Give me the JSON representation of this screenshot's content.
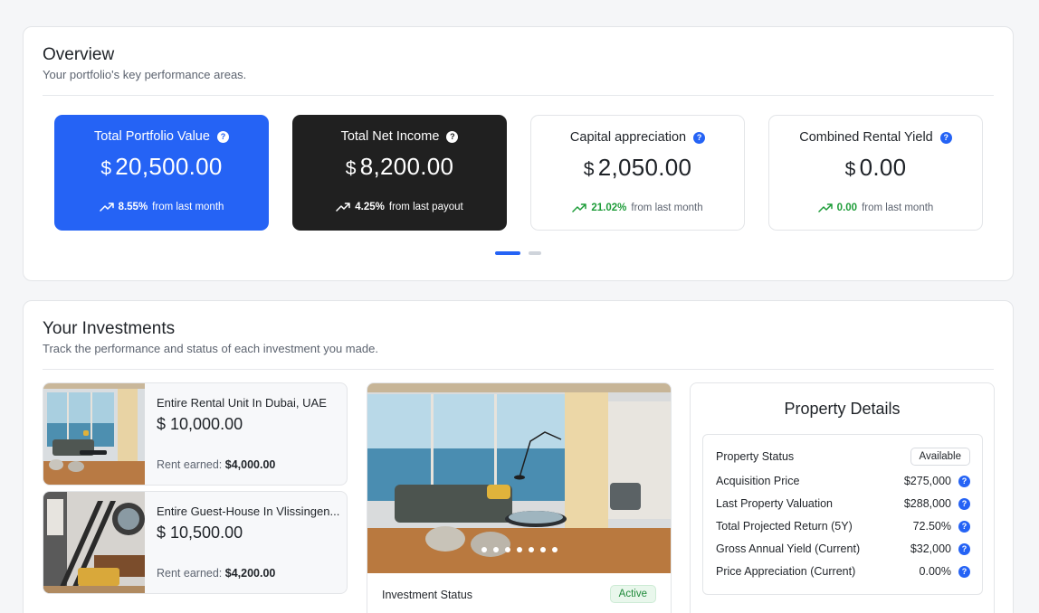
{
  "overview": {
    "title": "Overview",
    "subtitle": "Your portfolio's key performance areas.",
    "cards": [
      {
        "title": "Total Portfolio Value",
        "currency": "$",
        "value": "20,500.00",
        "pct": "8.55%",
        "note": "from last month"
      },
      {
        "title": "Total Net Income",
        "currency": "$",
        "value": "8,200.00",
        "pct": "4.25%",
        "note": "from last payout"
      },
      {
        "title": "Capital appreciation",
        "currency": "$",
        "value": "2,050.00",
        "pct": "21.02%",
        "note": "from last month"
      },
      {
        "title": "Combined Rental Yield",
        "currency": "$",
        "value": "0.00",
        "pct": "0.00",
        "note": "from last month"
      }
    ],
    "help_glyph": "?",
    "pager": {
      "total": 2,
      "active": 1
    }
  },
  "investments": {
    "title": "Your Investments",
    "subtitle": "Track the performance and status of each investment you made.",
    "items": [
      {
        "name": "Entire Rental Unit In Dubai, UAE",
        "price": "$ 10,000.00",
        "rent_label": "Rent earned:",
        "rent_value": "$4,000.00"
      },
      {
        "name": "Entire Guest-House In Vlissingen...",
        "price": "$ 10,500.00",
        "rent_label": "Rent earned:",
        "rent_value": "$4,200.00"
      }
    ],
    "gallery": {
      "image_count": 7,
      "status_label": "Investment Status",
      "status_value": "Active"
    }
  },
  "details": {
    "title": "Property Details",
    "rows": [
      {
        "label": "Property Status",
        "value": "Available"
      },
      {
        "label": "Acquisition Price",
        "value": "$275,000"
      },
      {
        "label": "Last Property Valuation",
        "value": "$288,000"
      },
      {
        "label": "Total Projected Return (5Y)",
        "value": "72.50%"
      },
      {
        "label": "Gross Annual Yield (Current)",
        "value": "$32,000"
      },
      {
        "label": "Price Appreciation (Current)",
        "value": "0.00%"
      }
    ]
  },
  "colors": {
    "accent": "#2563f5",
    "dark_card": "#202020",
    "positive": "#1f9d3a"
  }
}
